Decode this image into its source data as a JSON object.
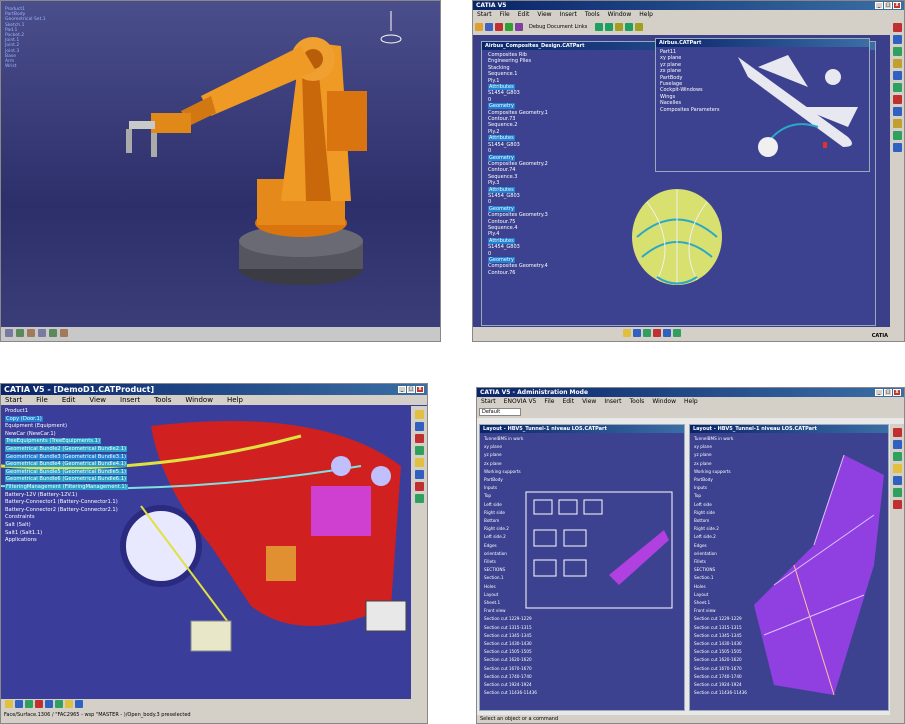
{
  "tl": {
    "tree_lines": [
      "Product1",
      "PartBody",
      "Geometrical Set.1",
      "Sketch.1",
      "Pad.1",
      "Pocket.2",
      "Joint.1",
      "Joint.2",
      "Joint.3",
      "Base",
      "Arm",
      "Wrist"
    ]
  },
  "tr": {
    "window_title": "CATIA V5",
    "menu": [
      "Start",
      "File",
      "Edit",
      "View",
      "Insert",
      "Tools",
      "Window",
      "Help"
    ],
    "debug_label": "Debug Document Links",
    "doc_title": "Airbus_Composites_Design.CATPart",
    "tree": [
      {
        "t": "Composites Rib",
        "s": ""
      },
      {
        "t": "Engineering Plies",
        "s": ""
      },
      {
        "t": "Stacking",
        "s": ""
      },
      {
        "t": "Sequence.1",
        "s": ""
      },
      {
        "t": "Ply.1",
        "s": ""
      },
      {
        "t": "Attributes",
        "s": "hl"
      },
      {
        "t": "S1454_G803",
        "s": ""
      },
      {
        "t": "0",
        "s": ""
      },
      {
        "t": "Geometry",
        "s": "hl"
      },
      {
        "t": "Composites Geometry.1",
        "s": ""
      },
      {
        "t": "Contour.73",
        "s": ""
      },
      {
        "t": "Sequence.2",
        "s": ""
      },
      {
        "t": "Ply.2",
        "s": ""
      },
      {
        "t": "Attributes",
        "s": "hl"
      },
      {
        "t": "S1454_G803",
        "s": ""
      },
      {
        "t": "0",
        "s": ""
      },
      {
        "t": "Geometry",
        "s": "hl"
      },
      {
        "t": "Composites Geometry.2",
        "s": ""
      },
      {
        "t": "Contour.74",
        "s": ""
      },
      {
        "t": "Sequence.3",
        "s": ""
      },
      {
        "t": "Ply.3",
        "s": ""
      },
      {
        "t": "Attributes",
        "s": "hl"
      },
      {
        "t": "S1454_G803",
        "s": ""
      },
      {
        "t": "0",
        "s": ""
      },
      {
        "t": "Geometry",
        "s": "hl"
      },
      {
        "t": "Composites Geometry.3",
        "s": ""
      },
      {
        "t": "Contour.75",
        "s": ""
      },
      {
        "t": "Sequence.4",
        "s": ""
      },
      {
        "t": "Ply.4",
        "s": ""
      },
      {
        "t": "Attributes",
        "s": "hl"
      },
      {
        "t": "S1454_G803",
        "s": ""
      },
      {
        "t": "0",
        "s": ""
      },
      {
        "t": "Geometry",
        "s": "hl"
      },
      {
        "t": "Composites Geometry.4",
        "s": ""
      },
      {
        "t": "Contour.76",
        "s": ""
      }
    ],
    "sub_title": "Airbus.CATPart",
    "sub_tree": [
      "Part11",
      "xy plane",
      "yz plane",
      "zx plane",
      "PartBody",
      "Fuselage",
      "Cockpit-Windows",
      "Wings",
      "Nacelles",
      "Composites Parameters"
    ],
    "logo": "CATIA"
  },
  "bl": {
    "window_title": "CATIA V5 - [DemoD1.CATProduct]",
    "menu": [
      "Start",
      "File",
      "Edit",
      "View",
      "Insert",
      "Tools",
      "Window",
      "Help"
    ],
    "tree": [
      {
        "t": "Product1",
        "s": ""
      },
      {
        "t": "Copy (Door.1)",
        "s": "hl"
      },
      {
        "t": "Equipment (Equipment)",
        "s": ""
      },
      {
        "t": "NewCar (NewCar.1)",
        "s": ""
      },
      {
        "t": "TreeEquipments (TreeEquipments.1)",
        "s": "cy"
      },
      {
        "t": "Geometrical Bundle2 (Geometrical Bundle2.1)",
        "s": "cy"
      },
      {
        "t": "Geometrical Bundle3 (Geometrical Bundle3.1)",
        "s": "hl"
      },
      {
        "t": "Geometrical Bundle4 (Geometrical Bundle4.1)",
        "s": "cy"
      },
      {
        "t": "Geometrical Bundle5 (Geometrical Bundle5.1)",
        "s": "cy"
      },
      {
        "t": "Geometrical Bundle6 (Geometrical Bundle6.1)",
        "s": "cy"
      },
      {
        "t": "FilteringManagement (FilteringManagement.1)",
        "s": "cy"
      },
      {
        "t": "Battery-12V (Battery-12V.1)",
        "s": ""
      },
      {
        "t": "Battery-Connector1 (Battery-Connector1.1)",
        "s": ""
      },
      {
        "t": "Battery-Connector2 (Battery-Connector2.1)",
        "s": ""
      },
      {
        "t": "Constraints",
        "s": ""
      },
      {
        "t": "Salt (Salt)",
        "s": ""
      },
      {
        "t": "Salt1 (Salt1.1)",
        "s": ""
      },
      {
        "t": "Applications",
        "s": ""
      }
    ],
    "status": "Face/Surface.1306 / \"FAC2965 - wsp \"MASTER - )/Open_body.3 preselected"
  },
  "br": {
    "window_title": "CATIA V5 - Administration Mode",
    "menu": [
      "Start",
      "ENOVIA V5",
      "File",
      "Edit",
      "View",
      "Insert",
      "Tools",
      "Window",
      "Help"
    ],
    "default_label": "Default",
    "left_title": "Layout - HBV5_Tunnel-1 niveau LOS.CATPart",
    "right_title": "Layout - HBV5_Tunnel-1 niveau LOS.CATPart",
    "left_tree": [
      "TunnelBMS in work",
      "xy plane",
      "yz plane",
      "zx plane",
      "Working supports",
      "PartBody",
      "Inputs",
      "Top",
      "Left side",
      "Right side",
      "Bottom",
      "Right side.2",
      "Left side.2",
      "Edges",
      "orientation",
      "Fillets",
      "SECTIONS",
      "Section.1",
      "Holes",
      "Layout",
      "Sheet.1",
      "Front view",
      "Section cut 1229-1229",
      "Section cut 1315-1315",
      "Section cut 1345-1345",
      "Section cut 1430-1430",
      "Section cut 1505-1505",
      "Section cut 1620-1620",
      "Section cut 1670-1670",
      "Section cut 1740-1740",
      "Section cut 1924-1924",
      "Section cut 11436-11436"
    ],
    "status": "Select an object or a command"
  }
}
